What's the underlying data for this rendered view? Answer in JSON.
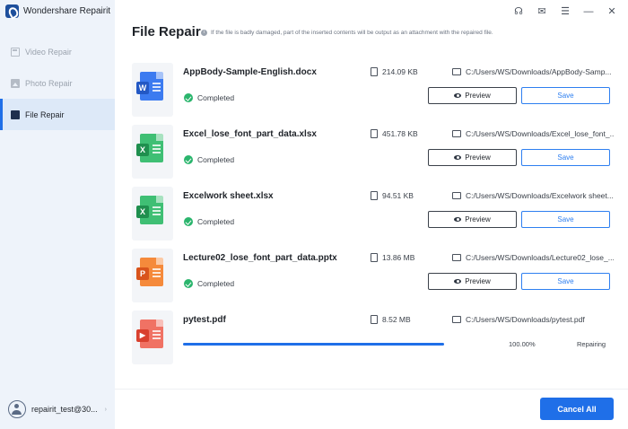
{
  "app": {
    "name": "Wondershare Repairit"
  },
  "sidebar": {
    "items": [
      {
        "label": "Video Repair",
        "icon": "video-icon",
        "active": false
      },
      {
        "label": "Photo Repair",
        "icon": "photo-icon",
        "active": false
      },
      {
        "label": "File Repair",
        "icon": "file-icon",
        "active": true
      }
    ],
    "user": {
      "name": "repairit_test@30...",
      "caret": "›"
    }
  },
  "window_controls": {
    "support": "☊",
    "mail": "✉",
    "menu": "☰",
    "minimize": "—",
    "close": "✕"
  },
  "main": {
    "title": "File Repair",
    "subtitle": "If the file is badly damaged, part of the inserted contents will be output as an attachment with the repaired file.",
    "files": [
      {
        "name": "AppBody-Sample-English.docx",
        "status": "Completed",
        "size": "214.09  KB",
        "path": "C:/Users/WS/Downloads/AppBody-Samp...",
        "type": "word",
        "badge": "W",
        "color": "#3c7bf0",
        "badge_color": "#2358c4",
        "preview_label": "Preview",
        "save_label": "Save"
      },
      {
        "name": "Excel_lose_font_part_data.xlsx",
        "status": "Completed",
        "size": "451.78  KB",
        "path": "C:/Users/WS/Downloads/Excel_lose_font_...",
        "type": "excel",
        "badge": "X",
        "color": "#3fbf74",
        "badge_color": "#1f8f4e",
        "preview_label": "Preview",
        "save_label": "Save"
      },
      {
        "name": "Excelwork sheet.xlsx",
        "status": "Completed",
        "size": "94.51  KB",
        "path": "C:/Users/WS/Downloads/Excelwork sheet...",
        "type": "excel",
        "badge": "X",
        "color": "#3fbf74",
        "badge_color": "#1f8f4e",
        "preview_label": "Preview",
        "save_label": "Save"
      },
      {
        "name": "Lecture02_lose_font_part_data.pptx",
        "status": "Completed",
        "size": "13.86  MB",
        "path": "C:/Users/WS/Downloads/Lecture02_lose_...",
        "type": "powerpoint",
        "badge": "P",
        "color": "#f58a3b",
        "badge_color": "#d9541c",
        "preview_label": "Preview",
        "save_label": "Save"
      }
    ],
    "repairing": {
      "name": "pytest.pdf",
      "size": "8.52  MB",
      "path": "C:/Users/WS/Downloads/pytest.pdf",
      "type": "pdf",
      "badge": "▶",
      "color": "#f07264",
      "badge_color": "#d9402e",
      "progress": 100,
      "percent_label": "100.00%",
      "state": "Repairing"
    },
    "cancel_all_label": "Cancel All"
  },
  "colors": {
    "accent": "#1f6fe8",
    "success": "#2bb56d",
    "sidebar_bg": "#eef3fa"
  }
}
